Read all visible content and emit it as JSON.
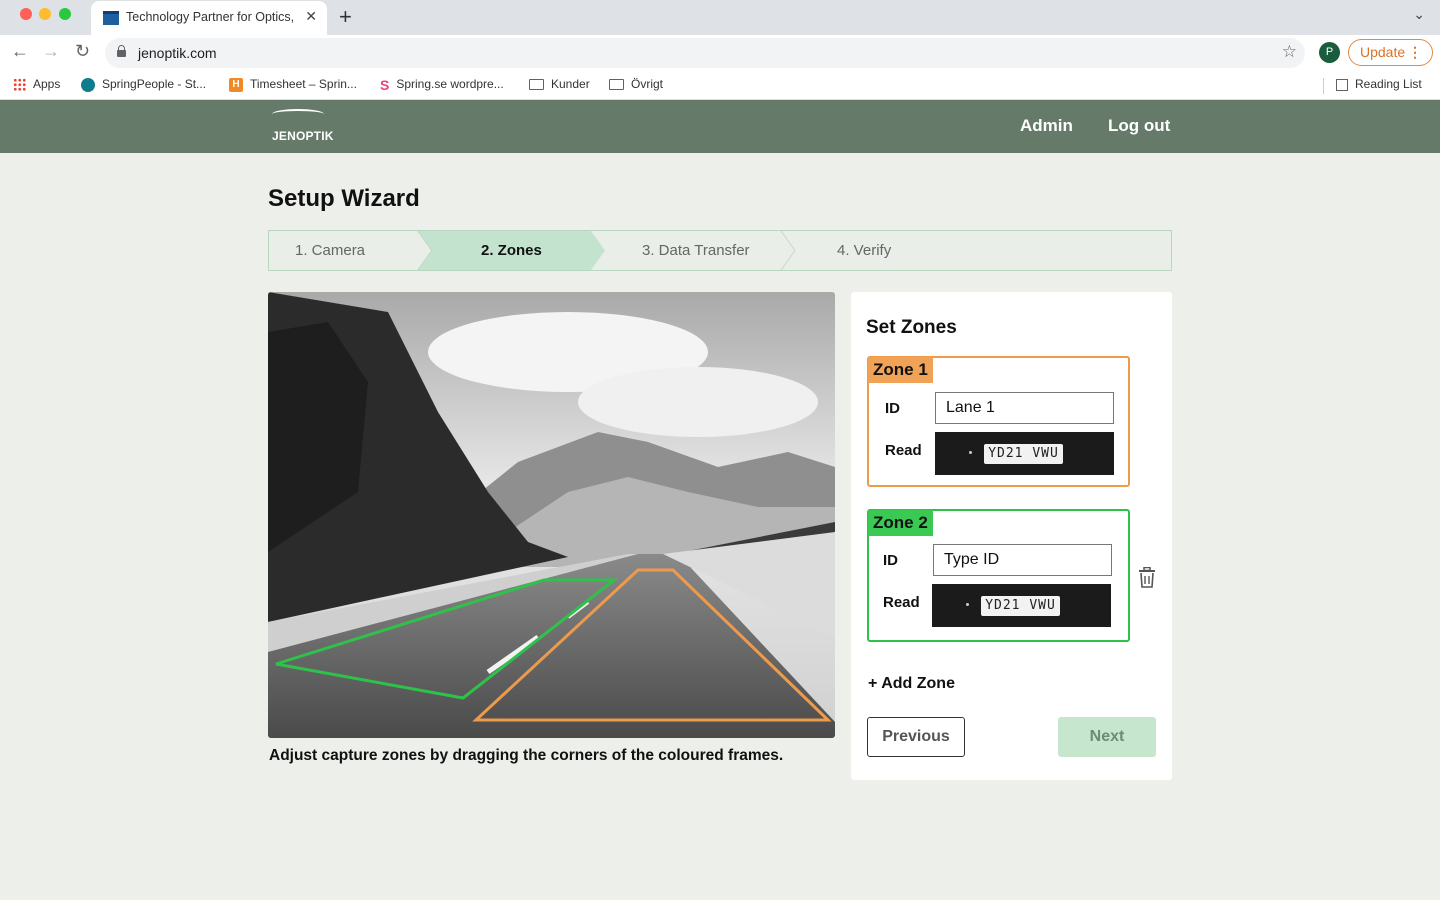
{
  "browser": {
    "tab_title": "Technology Partner for Optics,",
    "url": "jenoptik.com",
    "profile_initial": "P",
    "update_label": "Update",
    "bookmarks": [
      "Apps",
      "SpringPeople - St...",
      "Timesheet – Sprin...",
      "Spring.se wordpre...",
      "Kunder",
      "Övrigt"
    ],
    "reading_list": "Reading List"
  },
  "header": {
    "logo": "JENOPTIK",
    "admin": "Admin",
    "logout": "Log out"
  },
  "page": {
    "title": "Setup Wizard",
    "steps": [
      {
        "label": "1. Camera",
        "active": false
      },
      {
        "label": "2. Zones",
        "active": true
      },
      {
        "label": "3. Data Transfer",
        "active": false
      },
      {
        "label": "4. Verify",
        "active": false
      }
    ],
    "caption": "Adjust capture zones by dragging the corners of the coloured frames."
  },
  "zones_panel": {
    "title": "Set Zones",
    "zones": [
      {
        "tag": "Zone 1",
        "id_label": "ID",
        "id_value": "Lane 1",
        "id_placeholder": "",
        "read_label": "Read",
        "plate": "YD21 VWU",
        "color": "#ee9a4d"
      },
      {
        "tag": "Zone 2",
        "id_label": "ID",
        "id_value": "",
        "id_placeholder": "Type ID",
        "read_label": "Read",
        "plate": "YD21 VWU",
        "color": "#2fc24a"
      }
    ],
    "add_zone": "+ Add Zone",
    "previous": "Previous",
    "next": "Next"
  },
  "colors": {
    "header_bg": "#667a6a",
    "page_bg": "#ecefea",
    "step_active": "#c4e3cf",
    "zone1": "#ee9a4d",
    "zone2": "#2fc24a",
    "next_button": "#c6e6cd"
  },
  "icons": {
    "back": "arrow-left-icon",
    "forward": "arrow-right-icon",
    "reload": "reload-icon",
    "lock": "lock-icon",
    "star": "star-icon",
    "delete_zone": "trash-icon"
  }
}
